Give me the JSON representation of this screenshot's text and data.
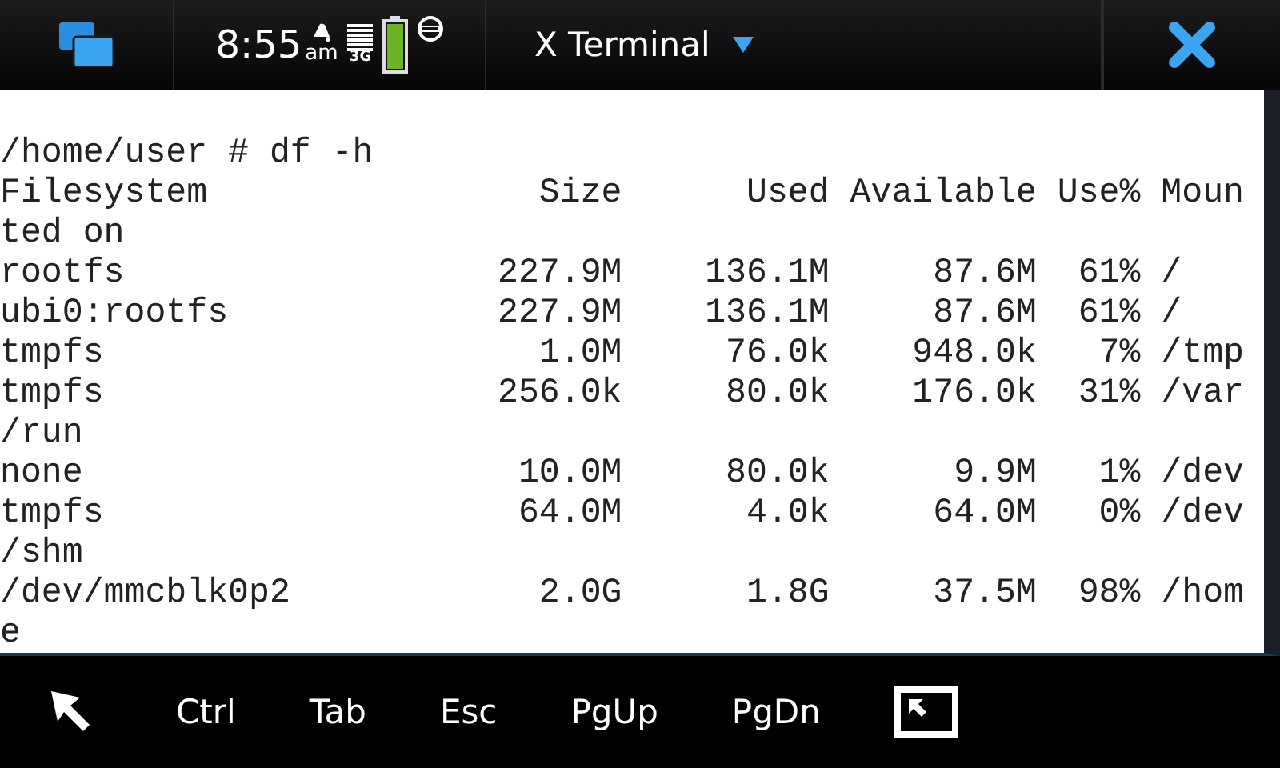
{
  "status_bar": {
    "time": "8:55",
    "meridiem": "am",
    "network": "3G",
    "title": "X Terminal"
  },
  "terminal": {
    "lines": [
      "/home/user # df -h",
      "Filesystem                Size      Used Available Use% Moun",
      "ted on",
      "rootfs                  227.9M    136.1M     87.6M  61% /",
      "ubi0:rootfs             227.9M    136.1M     87.6M  61% /",
      "tmpfs                     1.0M     76.0k    948.0k   7% /tmp",
      "tmpfs                   256.0k     80.0k    176.0k  31% /var",
      "/run",
      "none                     10.0M     80.0k      9.9M   1% /dev",
      "tmpfs                    64.0M      4.0k     64.0M   0% /dev",
      "/shm",
      "/dev/mmcblk0p2            2.0G      1.8G     37.5M  98% /hom",
      "e"
    ]
  },
  "toolbar": [
    {
      "kind": "pointer"
    },
    {
      "kind": "key",
      "label": "Ctrl"
    },
    {
      "kind": "key",
      "label": "Tab"
    },
    {
      "kind": "key",
      "label": "Esc"
    },
    {
      "kind": "key",
      "label": "PgUp"
    },
    {
      "kind": "key",
      "label": "PgDn"
    },
    {
      "kind": "fullscreen"
    }
  ]
}
